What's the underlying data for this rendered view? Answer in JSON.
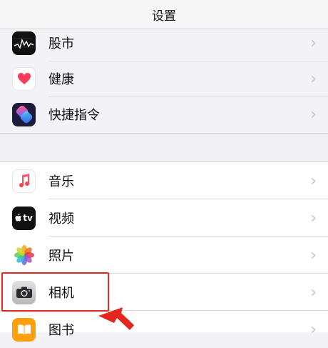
{
  "header": {
    "title": "设置"
  },
  "group1": [
    {
      "label": "股市",
      "icon": "stocks-icon"
    },
    {
      "label": "健康",
      "icon": "health-icon"
    },
    {
      "label": "快捷指令",
      "icon": "shortcuts-icon"
    }
  ],
  "group2": [
    {
      "label": "音乐",
      "icon": "music-icon"
    },
    {
      "label": "视频",
      "icon": "tv-icon",
      "icon_text": "tv"
    },
    {
      "label": "照片",
      "icon": "photos-icon"
    },
    {
      "label": "相机",
      "icon": "camera-icon"
    },
    {
      "label": "图书",
      "icon": "books-icon"
    }
  ],
  "chevron": "›",
  "colors": {
    "highlight": "#e5261f",
    "background": "#f2f2f7"
  }
}
